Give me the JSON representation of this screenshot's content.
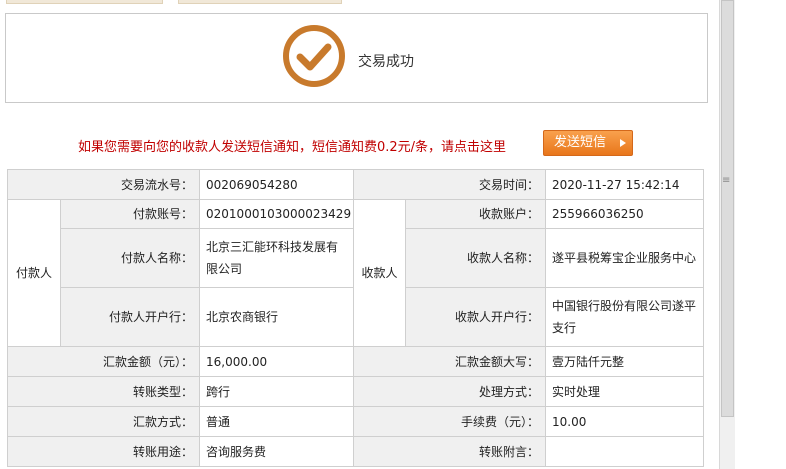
{
  "status": {
    "text": "交易成功",
    "icon": "check-circle-icon",
    "icon_color": "#c87a2c"
  },
  "sms": {
    "notice": "如果您需要向您的收款人发送短信通知，短信通知费0.2元/条，请点击这里",
    "button_label": "发送短信",
    "notice_color": "#c00000",
    "button_color": "#f08a2a"
  },
  "details": {
    "serial_label": "交易流水号：",
    "serial_value": "002069054280",
    "time_label": "交易时间：",
    "time_value": "2020-11-27 15:42:14",
    "payer_group": "付款人",
    "payee_group": "收款人",
    "payer_account_label": "付款账号：",
    "payer_account_value": "0201000103000023429",
    "payee_account_label": "收款账户：",
    "payee_account_value": "255966036250",
    "payer_name_label": "付款人名称：",
    "payer_name_value": "北京三汇能环科技发展有限公司",
    "payee_name_label": "收款人名称：",
    "payee_name_value": "遂平县税筹宝企业服务中心",
    "payer_bank_label": "付款人开户行：",
    "payer_bank_value": "北京农商银行",
    "payee_bank_label": "收款人开户行：",
    "payee_bank_value": "中国银行股份有限公司遂平支行",
    "amount_label": "汇款金额（元）：",
    "amount_value": "16,000.00",
    "amount_upper_label": "汇款金额大写：",
    "amount_upper_value": "壹万陆仟元整",
    "transfer_type_label": "转账类型：",
    "transfer_type_value": "跨行",
    "process_label": "处理方式：",
    "process_value": "实时处理",
    "remit_method_label": "汇款方式：",
    "remit_method_value": "普通",
    "fee_label": "手续费（元）：",
    "fee_value": "10.00",
    "purpose_label": "转账用途：",
    "purpose_value": "咨询服务费",
    "note_label": "转账附言：",
    "note_value": ""
  }
}
